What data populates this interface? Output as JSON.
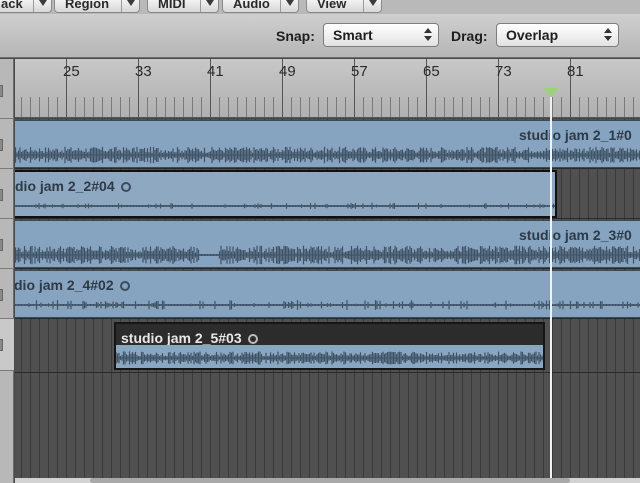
{
  "menus": [
    {
      "label": "ack"
    },
    {
      "label": "Region"
    },
    {
      "label": "MIDI"
    },
    {
      "label": "Audio"
    },
    {
      "label": "View"
    }
  ],
  "toolbar": {
    "snap_label": "Snap:",
    "snap_value": "Smart",
    "drag_label": "Drag:",
    "drag_value": "Overlap"
  },
  "ruler": {
    "bars": [
      "25",
      "33",
      "41",
      "49",
      "57",
      "65",
      "73",
      "81"
    ]
  },
  "regions": [
    {
      "name": "studio jam 2_1#0"
    },
    {
      "name": "dio jam 2_2#04"
    },
    {
      "name": "studio jam 2_3#0"
    },
    {
      "name": "dio jam 2_4#02"
    },
    {
      "name": "studio jam 2_5#03"
    }
  ],
  "colors": {
    "region_fill": "#86a3bf",
    "waveform": "#3f5365",
    "selected_region_header": "#2c2c2c",
    "playhead": "#f2f2f2",
    "playhead_marker": "#9ed27a"
  }
}
